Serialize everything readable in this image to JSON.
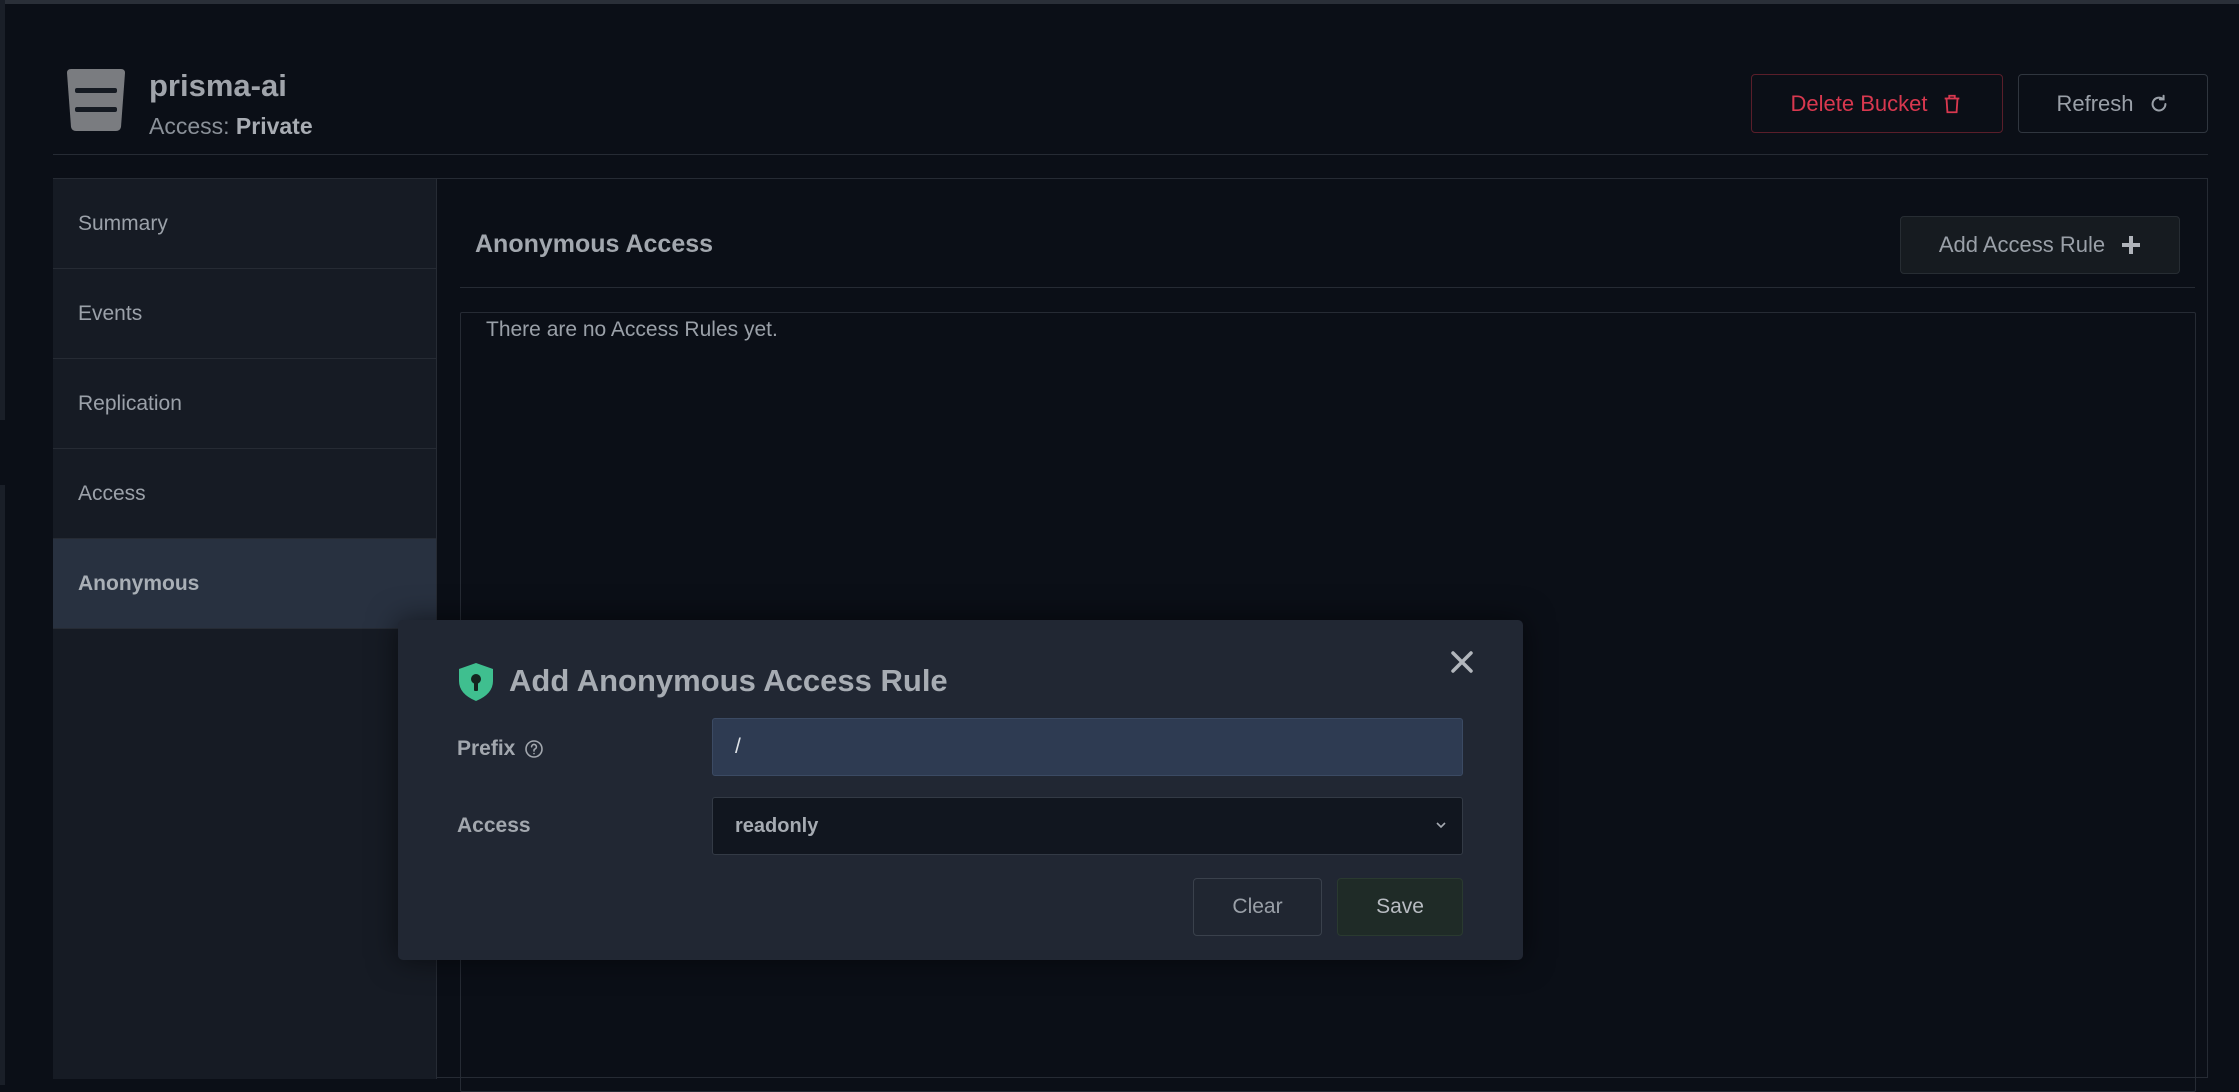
{
  "bucket": {
    "name": "prisma-ai",
    "access_label": "Access:",
    "access_value": "Private"
  },
  "header": {
    "delete_label": "Delete Bucket",
    "refresh_label": "Refresh"
  },
  "sidebar": {
    "items": [
      {
        "label": "Summary",
        "active": false
      },
      {
        "label": "Events",
        "active": false
      },
      {
        "label": "Replication",
        "active": false
      },
      {
        "label": "Access",
        "active": false
      },
      {
        "label": "Anonymous",
        "active": true
      }
    ]
  },
  "main": {
    "title": "Anonymous Access",
    "add_rule_label": "Add Access Rule",
    "empty_message": "There are no Access Rules yet."
  },
  "modal": {
    "title": "Add Anonymous Access Rule",
    "prefix_label": "Prefix",
    "prefix_value": "/",
    "access_label": "Access",
    "access_value": "readonly",
    "clear_label": "Clear",
    "save_label": "Save"
  },
  "icons": {
    "bucket": "bucket-icon",
    "delete": "trash-icon",
    "refresh": "refresh-icon",
    "add": "plus-icon",
    "close": "close-icon",
    "shield": "shield-icon",
    "help": "help-icon",
    "chevron": "chevron-down-icon"
  },
  "colors": {
    "danger": "#d8384f",
    "shield": "#3fbf8f",
    "background": "#0b0f17",
    "modal": "#212733",
    "prefix_input": "#2e3b52"
  }
}
